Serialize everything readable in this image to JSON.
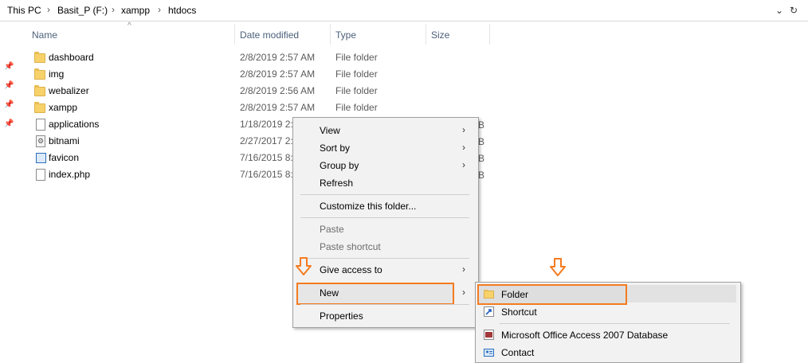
{
  "address": {
    "crumbs": [
      "This PC",
      "Basit_P (F:)",
      "xampp",
      "htdocs"
    ],
    "dropdown_icon": "chevron-down-icon",
    "refresh_icon": "refresh-icon"
  },
  "columns": {
    "name": "Name",
    "date": "Date modified",
    "type": "Type",
    "size": "Size"
  },
  "files": [
    {
      "name": "dashboard",
      "date": "2/8/2019 2:57 AM",
      "type": "File folder",
      "icon": "folder-icon"
    },
    {
      "name": "img",
      "date": "2/8/2019 2:57 AM",
      "type": "File folder",
      "icon": "folder-icon"
    },
    {
      "name": "webalizer",
      "date": "2/8/2019 2:56 AM",
      "type": "File folder",
      "icon": "folder-icon"
    },
    {
      "name": "xampp",
      "date": "2/8/2019 2:57 AM",
      "type": "File folder",
      "icon": "folder-icon"
    },
    {
      "name": "applications",
      "date": "1/18/2019 2:",
      "type": "",
      "icon": "file-icon",
      "trail": "B"
    },
    {
      "name": "bitnami",
      "date": "2/27/2017 2:",
      "type": "",
      "icon": "settings-file-icon",
      "trail": "B"
    },
    {
      "name": "favicon",
      "date": "7/16/2015 8:",
      "type": "",
      "icon": "image-file-icon",
      "trail": "B"
    },
    {
      "name": "index.php",
      "date": "7/16/2015 8:",
      "type": "",
      "icon": "file-icon",
      "trail": "B"
    }
  ],
  "context_menu": {
    "view": "View",
    "sort_by": "Sort by",
    "group_by": "Group by",
    "refresh": "Refresh",
    "customize": "Customize this folder...",
    "paste": "Paste",
    "paste_shortcut": "Paste shortcut",
    "give_access": "Give access to",
    "new": "New",
    "properties": "Properties"
  },
  "new_submenu": {
    "folder": "Folder",
    "shortcut": "Shortcut",
    "access_db": "Microsoft Office Access 2007 Database",
    "contact": "Contact"
  },
  "colors": {
    "highlight": "#f47b20",
    "header_text": "#4c607a",
    "folder": "#f7d26b"
  }
}
